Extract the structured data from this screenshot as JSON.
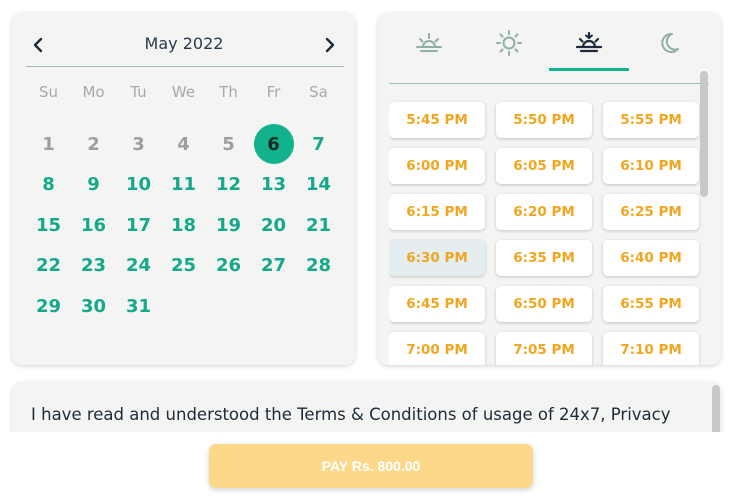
{
  "calendar": {
    "month_label": "May 2022",
    "prev_icon": "chevron-left-icon",
    "next_icon": "chevron-right-icon",
    "weekdays": [
      "Su",
      "Mo",
      "Tu",
      "We",
      "Th",
      "Fr",
      "Sa"
    ],
    "weeks": [
      [
        {
          "d": "1",
          "s": "past"
        },
        {
          "d": "2",
          "s": "past"
        },
        {
          "d": "3",
          "s": "past"
        },
        {
          "d": "4",
          "s": "past"
        },
        {
          "d": "5",
          "s": "past"
        },
        {
          "d": "6",
          "s": "selected"
        },
        {
          "d": "7",
          "s": "active"
        }
      ],
      [
        {
          "d": "8",
          "s": "active"
        },
        {
          "d": "9",
          "s": "active"
        },
        {
          "d": "10",
          "s": "active"
        },
        {
          "d": "11",
          "s": "active"
        },
        {
          "d": "12",
          "s": "active"
        },
        {
          "d": "13",
          "s": "active"
        },
        {
          "d": "14",
          "s": "active"
        }
      ],
      [
        {
          "d": "15",
          "s": "active"
        },
        {
          "d": "16",
          "s": "active"
        },
        {
          "d": "17",
          "s": "active"
        },
        {
          "d": "18",
          "s": "active"
        },
        {
          "d": "19",
          "s": "active"
        },
        {
          "d": "20",
          "s": "active"
        },
        {
          "d": "21",
          "s": "active"
        }
      ],
      [
        {
          "d": "22",
          "s": "active"
        },
        {
          "d": "23",
          "s": "active"
        },
        {
          "d": "24",
          "s": "active"
        },
        {
          "d": "25",
          "s": "active"
        },
        {
          "d": "26",
          "s": "active"
        },
        {
          "d": "27",
          "s": "active"
        },
        {
          "d": "28",
          "s": "active"
        }
      ],
      [
        {
          "d": "29",
          "s": "active"
        },
        {
          "d": "30",
          "s": "active"
        },
        {
          "d": "31",
          "s": "active"
        }
      ]
    ],
    "selected_day": "6"
  },
  "time_panel": {
    "tabs": [
      {
        "icon": "sunrise-icon",
        "active": false
      },
      {
        "icon": "sun-icon",
        "active": false
      },
      {
        "icon": "sunset-icon",
        "active": true
      },
      {
        "icon": "moon-icon",
        "active": false
      }
    ],
    "slots": [
      "5:45 PM",
      "5:50 PM",
      "5:55 PM",
      "6:00 PM",
      "6:05 PM",
      "6:10 PM",
      "6:15 PM",
      "6:20 PM",
      "6:25 PM",
      "6:30 PM",
      "6:35 PM",
      "6:40 PM",
      "6:45 PM",
      "6:50 PM",
      "6:55 PM",
      "7:00 PM",
      "7:05 PM",
      "7:10 PM"
    ],
    "highlighted_slot": "6:30 PM"
  },
  "terms": {
    "text": "I have read and understood the Terms & Conditions of usage of 24x7, Privacy policy, Refund Policy and consent to the use of my clinical details and those of the people"
  },
  "pay": {
    "label": "PAY Rs. 800.00"
  },
  "colors": {
    "accent": "#12b28c",
    "slot_text": "#f2a51e",
    "pay_button": "#fcd98a"
  }
}
